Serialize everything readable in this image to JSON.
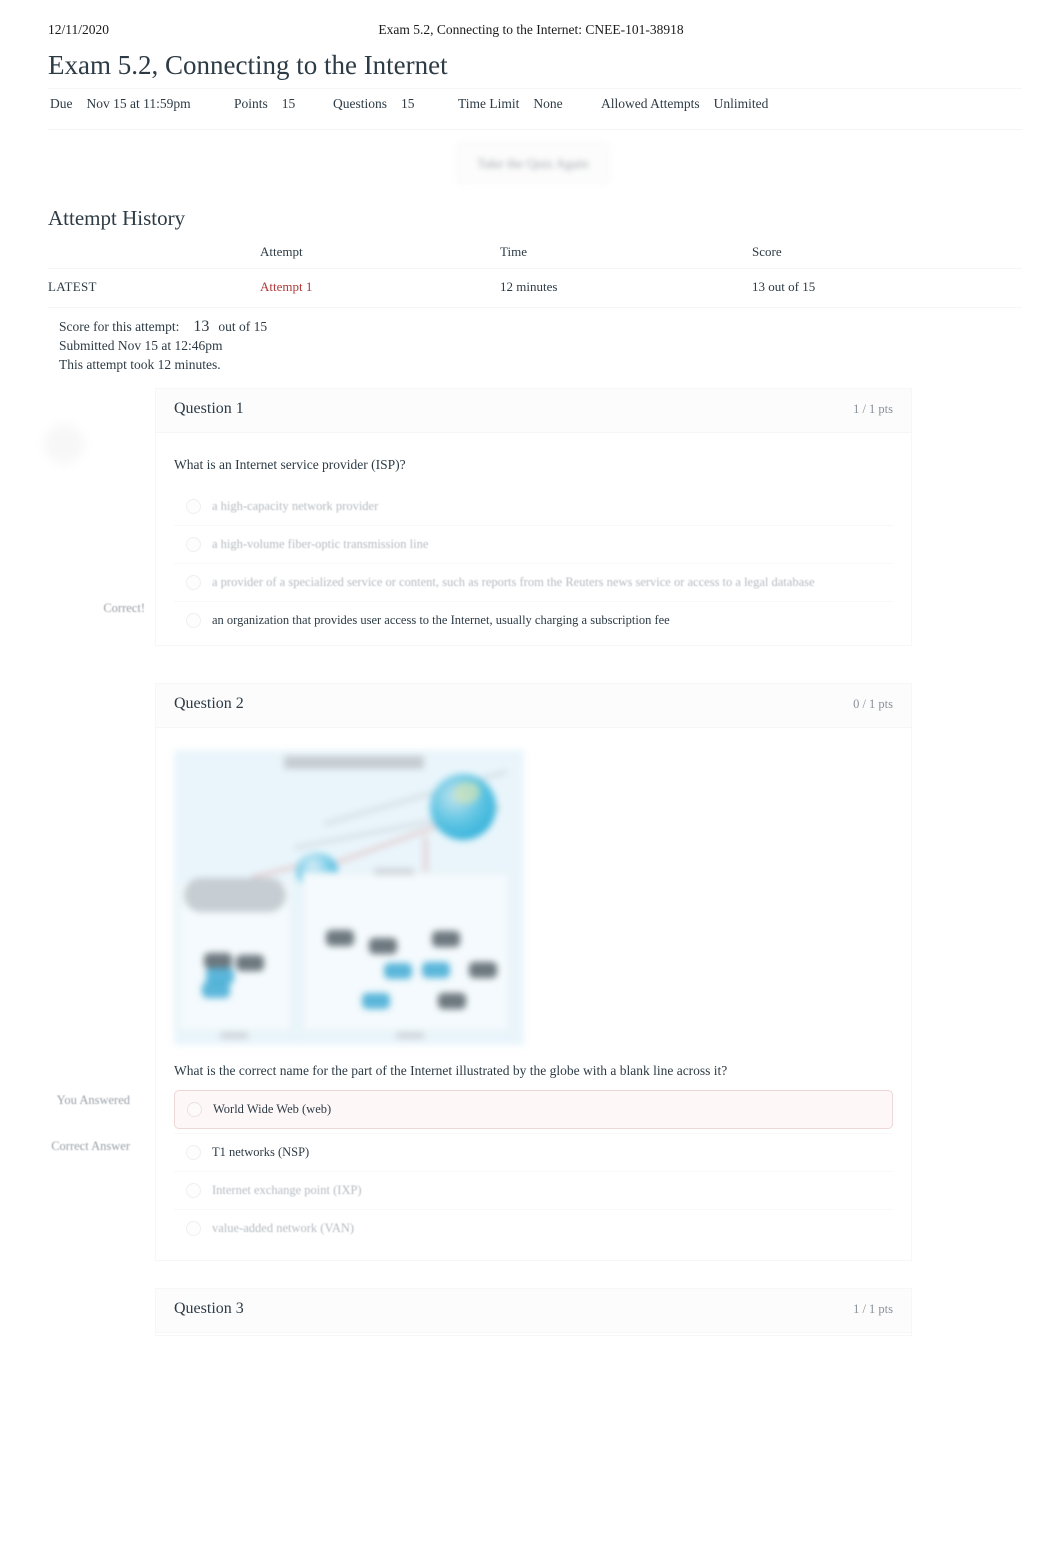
{
  "print_header": {
    "date": "12/11/2020",
    "title": "Exam 5.2, Connecting to the Internet: CNEE-101-38918"
  },
  "quiz": {
    "title": "Exam 5.2, Connecting to the Internet",
    "meta": {
      "due_label": "Due",
      "due_value": "Nov 15 at 11:59pm",
      "points_label": "Points",
      "points_value": "15",
      "questions_label": "Questions",
      "questions_value": "15",
      "time_limit_label": "Time Limit",
      "time_limit_value": "None",
      "allowed_attempts_label": "Allowed Attempts",
      "allowed_attempts_value": "Unlimited"
    },
    "retake_button": "Take the Quiz Again"
  },
  "attempt_history": {
    "heading": "Attempt History",
    "columns": [
      "",
      "Attempt",
      "Time",
      "Score"
    ],
    "rows": [
      {
        "kept": "LATEST",
        "attempt": "Attempt 1",
        "time": "12 minutes",
        "score": "13 out of 15"
      }
    ]
  },
  "score_summary": {
    "score_label": "Score for this attempt:",
    "score_value": "13",
    "score_out_of": "out of 15",
    "submitted": "Submitted Nov 15 at 12:46pm",
    "duration": "This attempt took 12 minutes."
  },
  "questions": [
    {
      "name": "Question 1",
      "points": "1 / 1 pts",
      "text": "What is an Internet service provider (ISP)?",
      "answers": [
        {
          "text": "a high-capacity network provider",
          "state": "plain",
          "gutter": ""
        },
        {
          "text": "a high-volume fiber-optic transmission line",
          "state": "plain",
          "gutter": ""
        },
        {
          "text": "a provider of a specialized service or content, such as reports from the Reuters news service or access to a legal database",
          "state": "plain",
          "gutter": ""
        },
        {
          "text": "an organization that provides user access to the Internet, usually charging a subscription fee",
          "state": "correct",
          "gutter": "Correct!"
        }
      ]
    },
    {
      "name": "Question 2",
      "points": "0 / 1 pts",
      "text": "What is the correct name for the part of the Internet illustrated by the globe with a blank line across it?",
      "has_figure": true,
      "figure_alt": "network-diagram",
      "answers": [
        {
          "text": "World Wide Web (web)",
          "state": "selected-wrong",
          "gutter": "You Answered"
        },
        {
          "text": "T1 networks (NSP)",
          "state": "correct-answer",
          "gutter": "Correct Answer"
        },
        {
          "text": "Internet exchange point (IXP)",
          "state": "plain",
          "gutter": ""
        },
        {
          "text": "value-added network (VAN)",
          "state": "plain",
          "gutter": ""
        }
      ]
    },
    {
      "name": "Question 3",
      "points": "1 / 1 pts",
      "text": "",
      "answers": []
    }
  ],
  "colors": {
    "attempt_link": "#ad393a",
    "wrong_border": "#f0d7d7",
    "wrong_bg": "#fdf7f7",
    "text": "#2d3b45",
    "muted": "#8a9199"
  }
}
